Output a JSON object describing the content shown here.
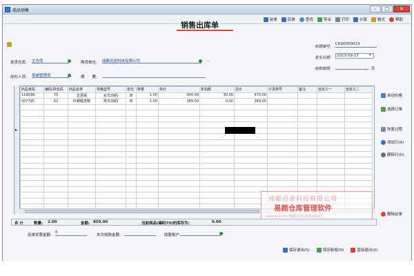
{
  "window": {
    "title": "商品销售"
  },
  "toolbar": {
    "items": [
      {
        "label": "前单",
        "icon": "arrow-left-icon"
      },
      {
        "label": "后单",
        "icon": "arrow-right-icon"
      },
      {
        "label": "查找",
        "icon": "search-icon"
      },
      {
        "label": "导出",
        "icon": "export-icon"
      },
      {
        "label": "打印",
        "icon": "print-icon"
      },
      {
        "label": "计算",
        "icon": "calculator-icon"
      },
      {
        "label": "格式",
        "icon": "format-icon"
      },
      {
        "label": "帮助",
        "icon": "help-icon"
      }
    ]
  },
  "document": {
    "title": "销售出库单"
  },
  "header": {
    "warehouse_label": "发货仓库:",
    "warehouse_value": "主仓库",
    "buyer_label": "购货单位:",
    "buyer_value": "成都迅途科技有限公司",
    "handler_label": "经办人员:",
    "handler_value": "系统管理员",
    "summary_label": "摘　　要:",
    "summary_value": "",
    "doc_no_label": "单据编号:",
    "doc_no_value": "CK00000023",
    "date_label": "发生日期:",
    "date_value": "2013-09-17",
    "due_label": "收款期限:",
    "due_value": "",
    "due_unit": "天"
  },
  "grid": {
    "columns": [
      "商品条码",
      "编码/拼音码",
      "商品名称",
      "规格型号",
      "单位",
      "数量",
      "单价",
      "折扣额",
      "总价",
      "订货单号",
      "备注",
      "自定义一",
      "自定义二"
    ],
    "rows": [
      [
        "118099",
        "70",
        "达芙妮",
        "女式39码",
        "双",
        "1.00",
        "400.00",
        "30.00",
        "470.00",
        "",
        "",
        "",
        ""
      ],
      [
        "507795",
        "62",
        "红蜻蜓皮鞋",
        "男式39码",
        "双",
        "1.00",
        "389.00",
        "0.00",
        "389.00",
        "",
        "",
        "",
        ""
      ]
    ]
  },
  "side_actions": [
    {
      "label": "自动价格",
      "icon": "auto-price-icon"
    },
    {
      "label": "选择订单",
      "icon": "select-order-icon"
    },
    {
      "label": "恢复过程",
      "icon": "restore-icon"
    },
    {
      "label": "添加行(A)",
      "icon": "add-row-icon"
    },
    {
      "label": "删除行(D)",
      "icon": "delete-row-icon"
    },
    {
      "label": "删除此单",
      "icon": "delete-doc-icon"
    }
  ],
  "totals": {
    "label": "合 计",
    "qty_label": "数量:",
    "qty_value": "2.00",
    "amount_label": "金额:",
    "amount_value": "859.00",
    "stock_label": "当前商品(编码70)的库存为:",
    "stock_value": "0.00"
  },
  "payment": {
    "discount_label": "此单优惠金额:",
    "discount_value": "0",
    "received_label": "本次收款金额:",
    "received_value": "",
    "account_label": "收款账户:",
    "account_value": ""
  },
  "watermark": {
    "company": "成都迅途科技有限公司",
    "product": "易颜仓库管理软件",
    "contact": "www.lsxt.net  电话:028-83144123"
  },
  "footer": {
    "save_exit": "保存退出(S)",
    "save_new": "保存新增(N)",
    "exit": "直接退出(X)"
  }
}
